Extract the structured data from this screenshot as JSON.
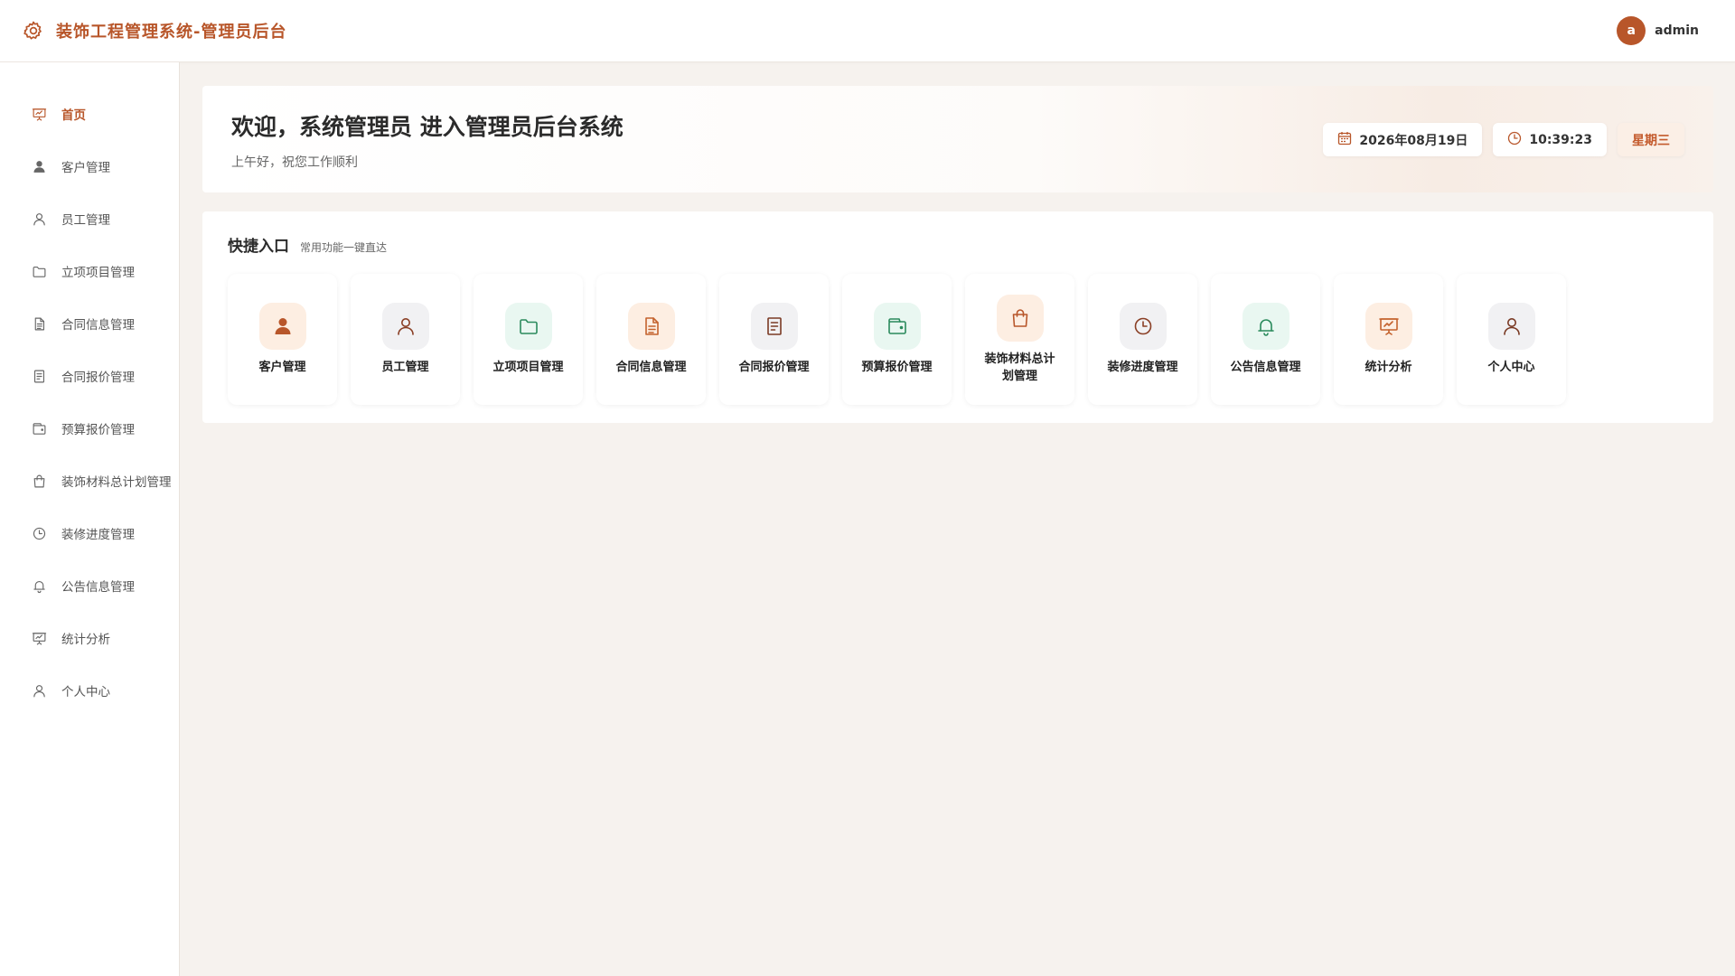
{
  "header": {
    "title": "装饰工程管理系统-管理员后台",
    "brand_icon": "gear-icon",
    "user": {
      "avatar_letter": "a",
      "name": "admin"
    }
  },
  "sidebar": {
    "items": [
      {
        "label": "首页",
        "icon": "presentation-icon",
        "active": true
      },
      {
        "label": "客户管理",
        "icon": "user-filled-icon"
      },
      {
        "label": "员工管理",
        "icon": "user-icon"
      },
      {
        "label": "立项项目管理",
        "icon": "folder-icon"
      },
      {
        "label": "合同信息管理",
        "icon": "document-icon"
      },
      {
        "label": "合同报价管理",
        "icon": "tickets-icon"
      },
      {
        "label": "预算报价管理",
        "icon": "wallet-icon"
      },
      {
        "label": "装饰材料总计划管理",
        "icon": "shopping-bag-icon"
      },
      {
        "label": "装修进度管理",
        "icon": "clock-icon"
      },
      {
        "label": "公告信息管理",
        "icon": "bell-icon"
      },
      {
        "label": "统计分析",
        "icon": "presentation-icon"
      },
      {
        "label": "个人中心",
        "icon": "user-icon"
      }
    ]
  },
  "welcome": {
    "title": "欢迎，系统管理员 进入管理员后台系统",
    "subtitle": "上午好，祝您工作顺利",
    "date": "2026年08月19日",
    "time": "10:39:23",
    "weekday": "星期三"
  },
  "quick": {
    "title": "快捷入口",
    "subtitle": "常用功能一键直达",
    "tiles": [
      {
        "label": "客户管理",
        "icon": "user-filled-icon"
      },
      {
        "label": "员工管理",
        "icon": "user-icon"
      },
      {
        "label": "立项项目管理",
        "icon": "folder-icon"
      },
      {
        "label": "合同信息管理",
        "icon": "document-icon"
      },
      {
        "label": "合同报价管理",
        "icon": "tickets-icon"
      },
      {
        "label": "预算报价管理",
        "icon": "wallet-icon"
      },
      {
        "label": "装饰材料总计划管理",
        "icon": "shopping-bag-icon"
      },
      {
        "label": "装修进度管理",
        "icon": "clock-icon"
      },
      {
        "label": "公告信息管理",
        "icon": "bell-icon"
      },
      {
        "label": "统计分析",
        "icon": "presentation-icon"
      },
      {
        "label": "个人中心",
        "icon": "user-icon"
      }
    ]
  },
  "colors": {
    "accent": "#b8562a",
    "background": "#f6f2ee",
    "green": "#2a8a5c"
  }
}
